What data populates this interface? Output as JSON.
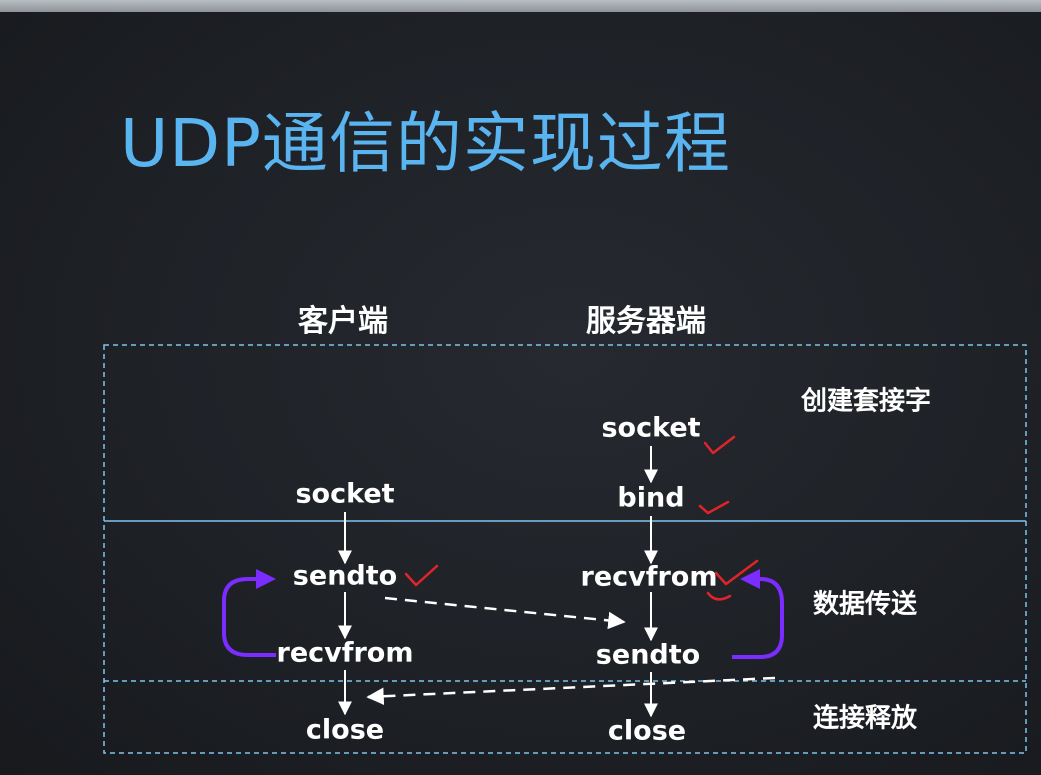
{
  "title": "UDP通信的实现过程",
  "columns": {
    "client": "客户端",
    "server": "服务器端"
  },
  "phases": {
    "create": "创建套接字",
    "transfer": "数据传送",
    "release": "连接释放"
  },
  "client_steps": {
    "socket": "socket",
    "sendto": "sendto",
    "recvfrom": "recvfrom",
    "close": "close"
  },
  "server_steps": {
    "socket": "socket",
    "bind": "bind",
    "recvfrom": "recvfrom",
    "sendto": "sendto",
    "close": "close"
  },
  "colors": {
    "title": "#5ab4f0",
    "text": "#ffffff",
    "border": "#7fc4ee",
    "loop": "#7b2cff",
    "check": "#e0242a"
  }
}
